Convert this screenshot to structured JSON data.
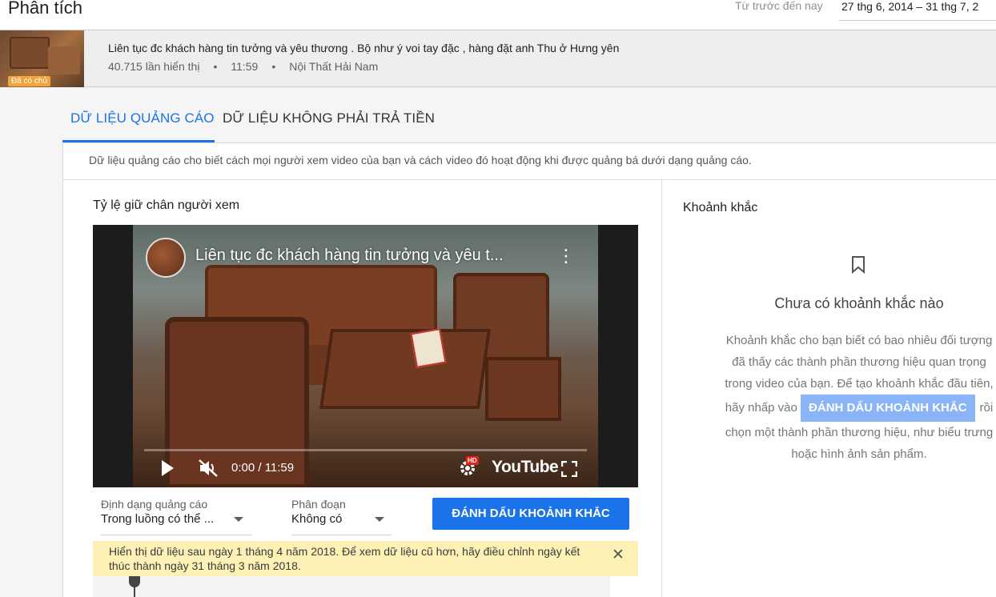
{
  "header": {
    "title": "Phân tích",
    "range_label": "Từ trước đến nay",
    "date_range": "27 thg 6, 2014 – 31 thg 7, 2"
  },
  "video": {
    "title": "Liên tục đc khách hàng tin tưởng và yêu thương . Bộ như ý voi tay đặc , hàng đặt anh Thu ở Hưng yên",
    "views": "40.715 lần hiển thị",
    "duration": "11:59",
    "channel": "Nội Thất Hải Nam",
    "badge": "Đã có chủ",
    "separator": "•"
  },
  "tabs": [
    {
      "label": "DỮ LIỆU QUẢNG CÁO",
      "active": true
    },
    {
      "label": "DỮ LIỆU KHÔNG PHẢI TRẢ TIỀN",
      "active": false
    }
  ],
  "card": {
    "description": "Dữ liệu quảng cáo cho biết cách mọi người xem video của bạn và cách video đó hoạt động khi được quảng bá dưới dạng quảng cáo."
  },
  "retention": {
    "title": "Tỷ lệ giữ chân người xem",
    "player": {
      "title": "Liên tục đc khách hàng tin tưởng và yêu t...",
      "more": "⋮",
      "time": "0:00 / 11:59",
      "hd": "HD",
      "brand": "YouTube",
      "progress": 0
    },
    "ad_format": {
      "label": "Định dạng quảng cáo",
      "value": "Trong luồng có thể ..."
    },
    "segment": {
      "label": "Phân đoạn",
      "value": "Không có"
    },
    "mark_button": "ĐÁNH DẤU KHOẢNH KHẮC",
    "notice": "Hiển thị dữ liệu sau ngày 1 tháng 4 năm 2018. Để xem dữ liệu cũ hơn, hãy điều chỉnh ngày kết thúc thành ngày 31 tháng 3 năm 2018.",
    "notice_close": "✕"
  },
  "moments": {
    "title": "Khoảnh khắc",
    "empty_title": "Chưa có khoảnh khắc nào",
    "desc_before": "Khoảnh khắc cho bạn biết có bao nhiêu đối tượng đã thấy các thành phần thương hiệu quan trọng trong video của bạn. Để tạo khoảnh khắc đầu tiên, hãy nhấp vào",
    "chip": "ĐÁNH DẤU KHOẢNH KHẮC",
    "desc_after": "rồi chọn một thành phần thương hiệu, như biểu trưng hoặc hình ảnh sản phẩm."
  },
  "colors": {
    "accent": "#1a73e8",
    "notice_bg": "#fdf1b6",
    "chip_bg": "#8ab4f8",
    "badge_bg": "#f2a33a"
  }
}
